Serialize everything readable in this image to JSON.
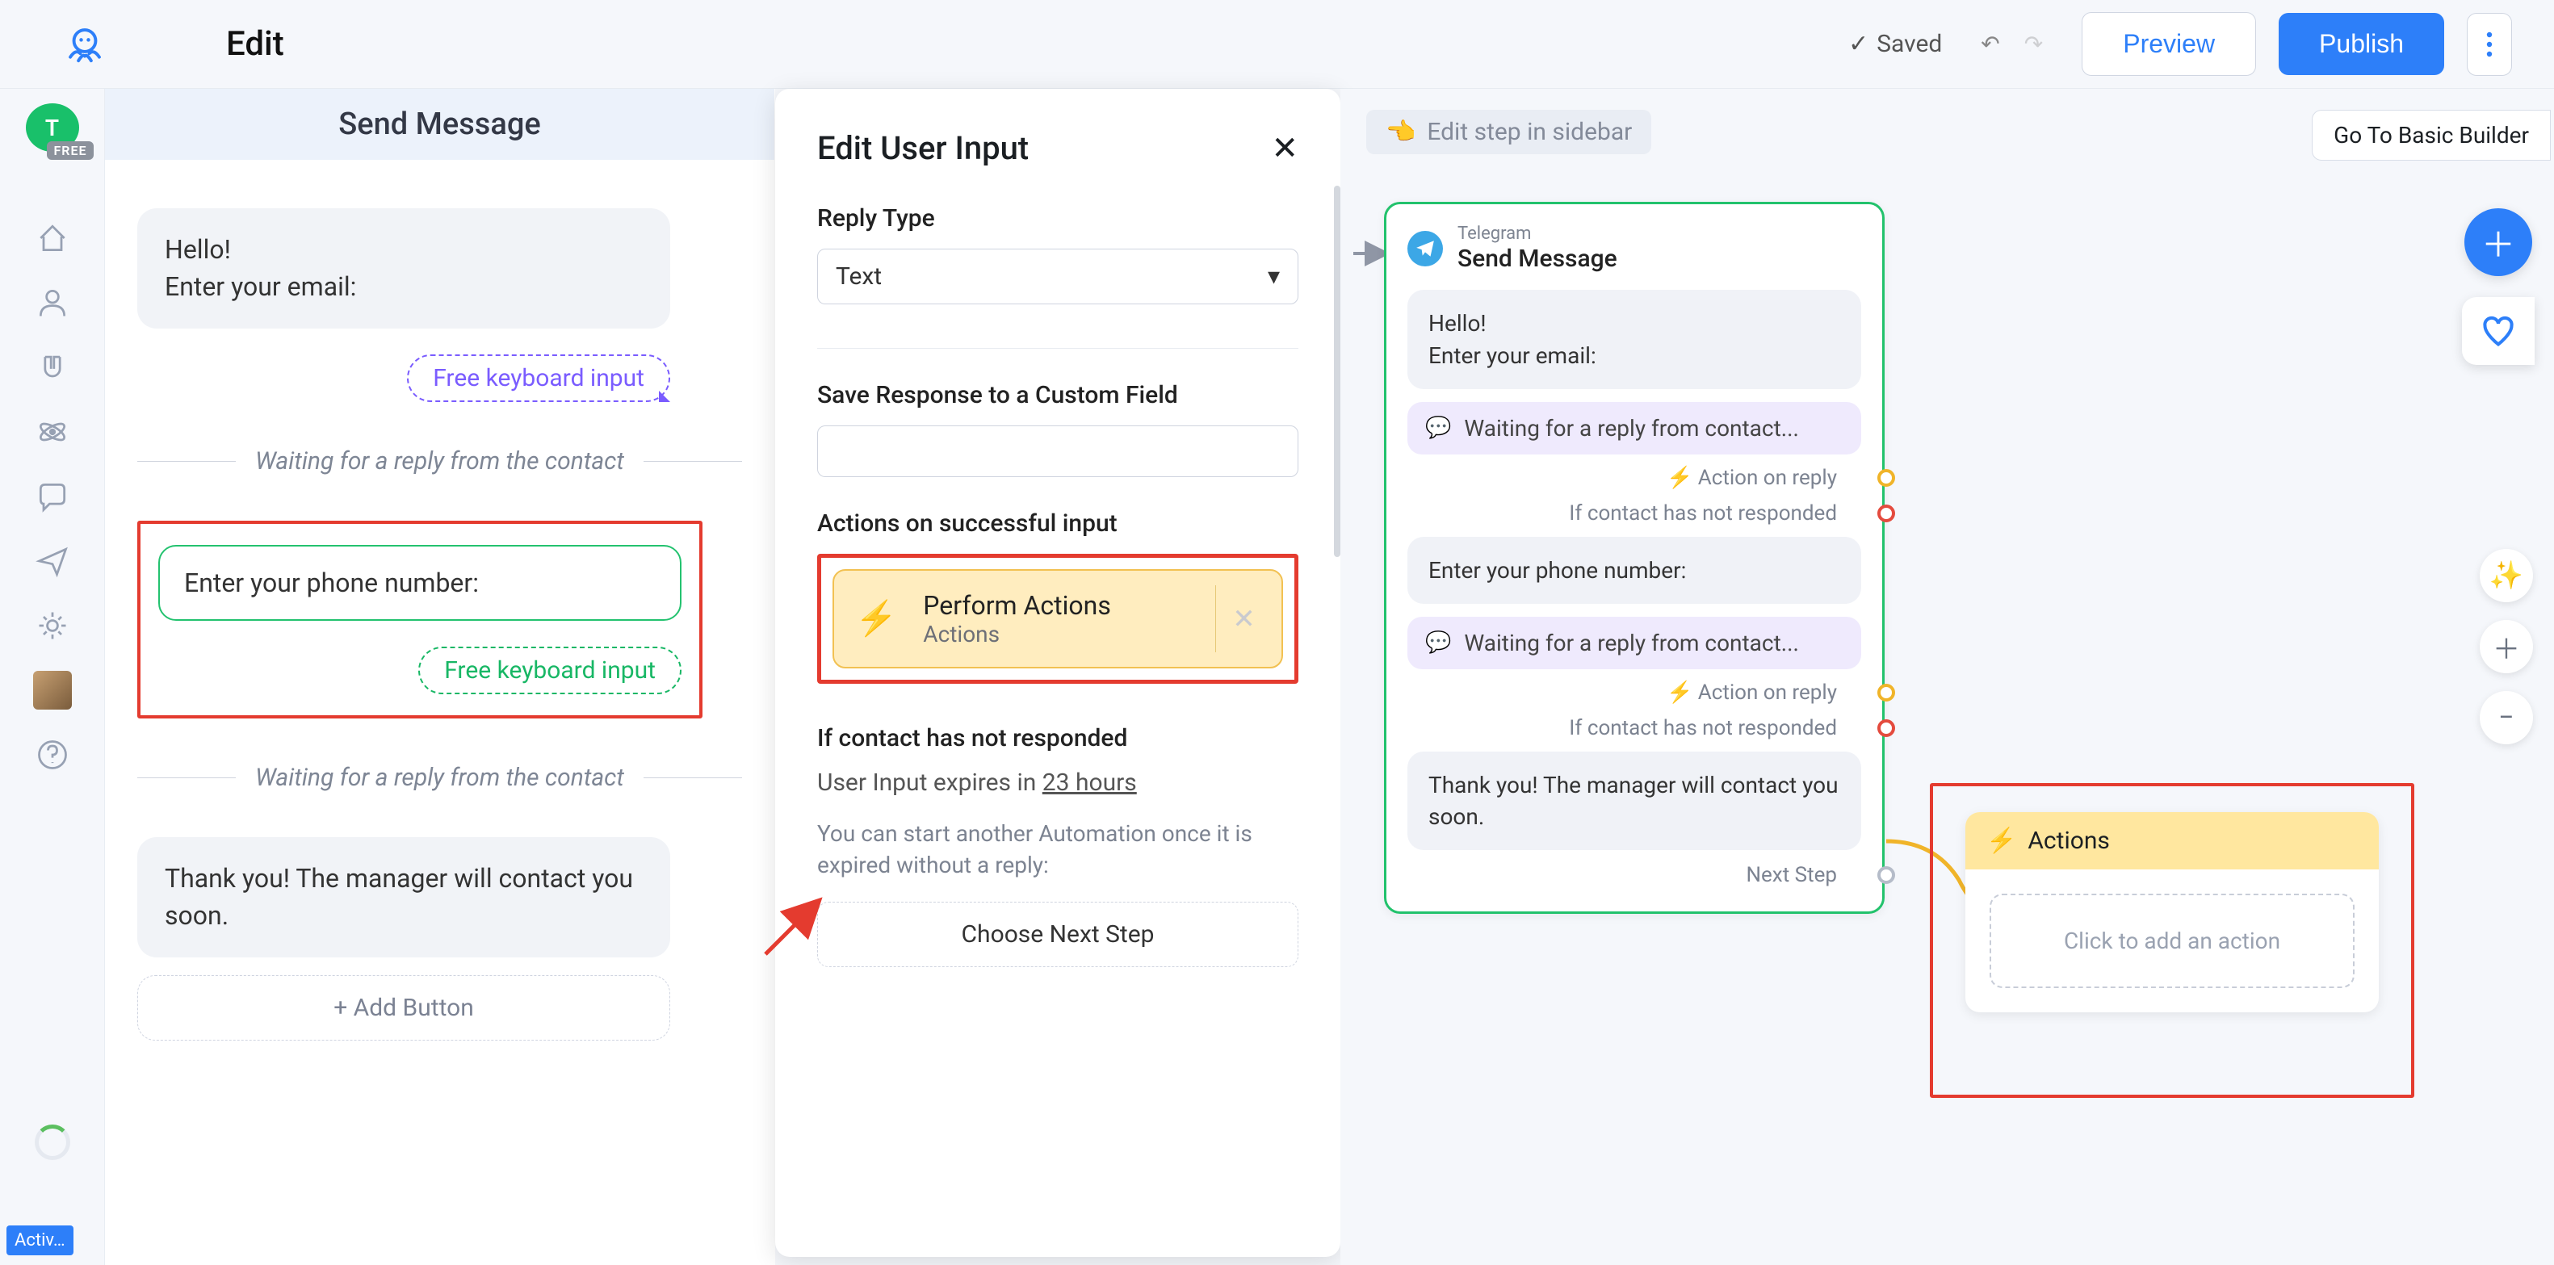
{
  "topbar": {
    "title": "Edit",
    "saved_label": "Saved",
    "preview_label": "Preview",
    "publish_label": "Publish"
  },
  "left_rail": {
    "account_initial": "T",
    "free_tag": "FREE",
    "activ_label": "Activ…"
  },
  "col1": {
    "header": "Send Message",
    "bubble1_line1": "Hello!",
    "bubble1_line2": "Enter your email:",
    "free_input_purple": "Free keyboard input",
    "waiting1": "Waiting for a reply from the contact",
    "phone_prompt": "Enter your phone number:",
    "free_input_green": "Free keyboard input",
    "waiting2": "Waiting for a reply from the contact",
    "thank_you": "Thank you! The manager will contact you soon.",
    "add_button_label": "+ Add Button"
  },
  "panel": {
    "title": "Edit User Input",
    "reply_type_label": "Reply Type",
    "reply_type_value": "Text",
    "save_custom_label": "Save Response to a Custom Field",
    "actions_success_label": "Actions on successful input",
    "perform_actions_title": "Perform Actions",
    "perform_actions_sub": "Actions",
    "not_responded_label": "If contact has not responded",
    "expire_prefix": "User Input expires in ",
    "expire_value": "23 hours",
    "expire_help": "You can start another Automation once it is expired without a reply:",
    "choose_next": "Choose Next Step"
  },
  "canvas": {
    "edit_sidebar_label": "Edit step in sidebar",
    "go_basic": "Go To Basic Builder",
    "card": {
      "platform": "Telegram",
      "title": "Send Message",
      "bubble1_line1": "Hello!",
      "bubble1_line2": "Enter your email:",
      "waiting": "Waiting for a reply from contact...",
      "action_reply": "Action on reply",
      "not_responded": "If contact has not responded",
      "phone_prompt": "Enter your phone number:",
      "thank_you": "Thank you! The manager will contact you soon.",
      "next_step": "Next Step"
    },
    "actions_card": {
      "title": "Actions",
      "add_label": "Click to add an action"
    }
  }
}
